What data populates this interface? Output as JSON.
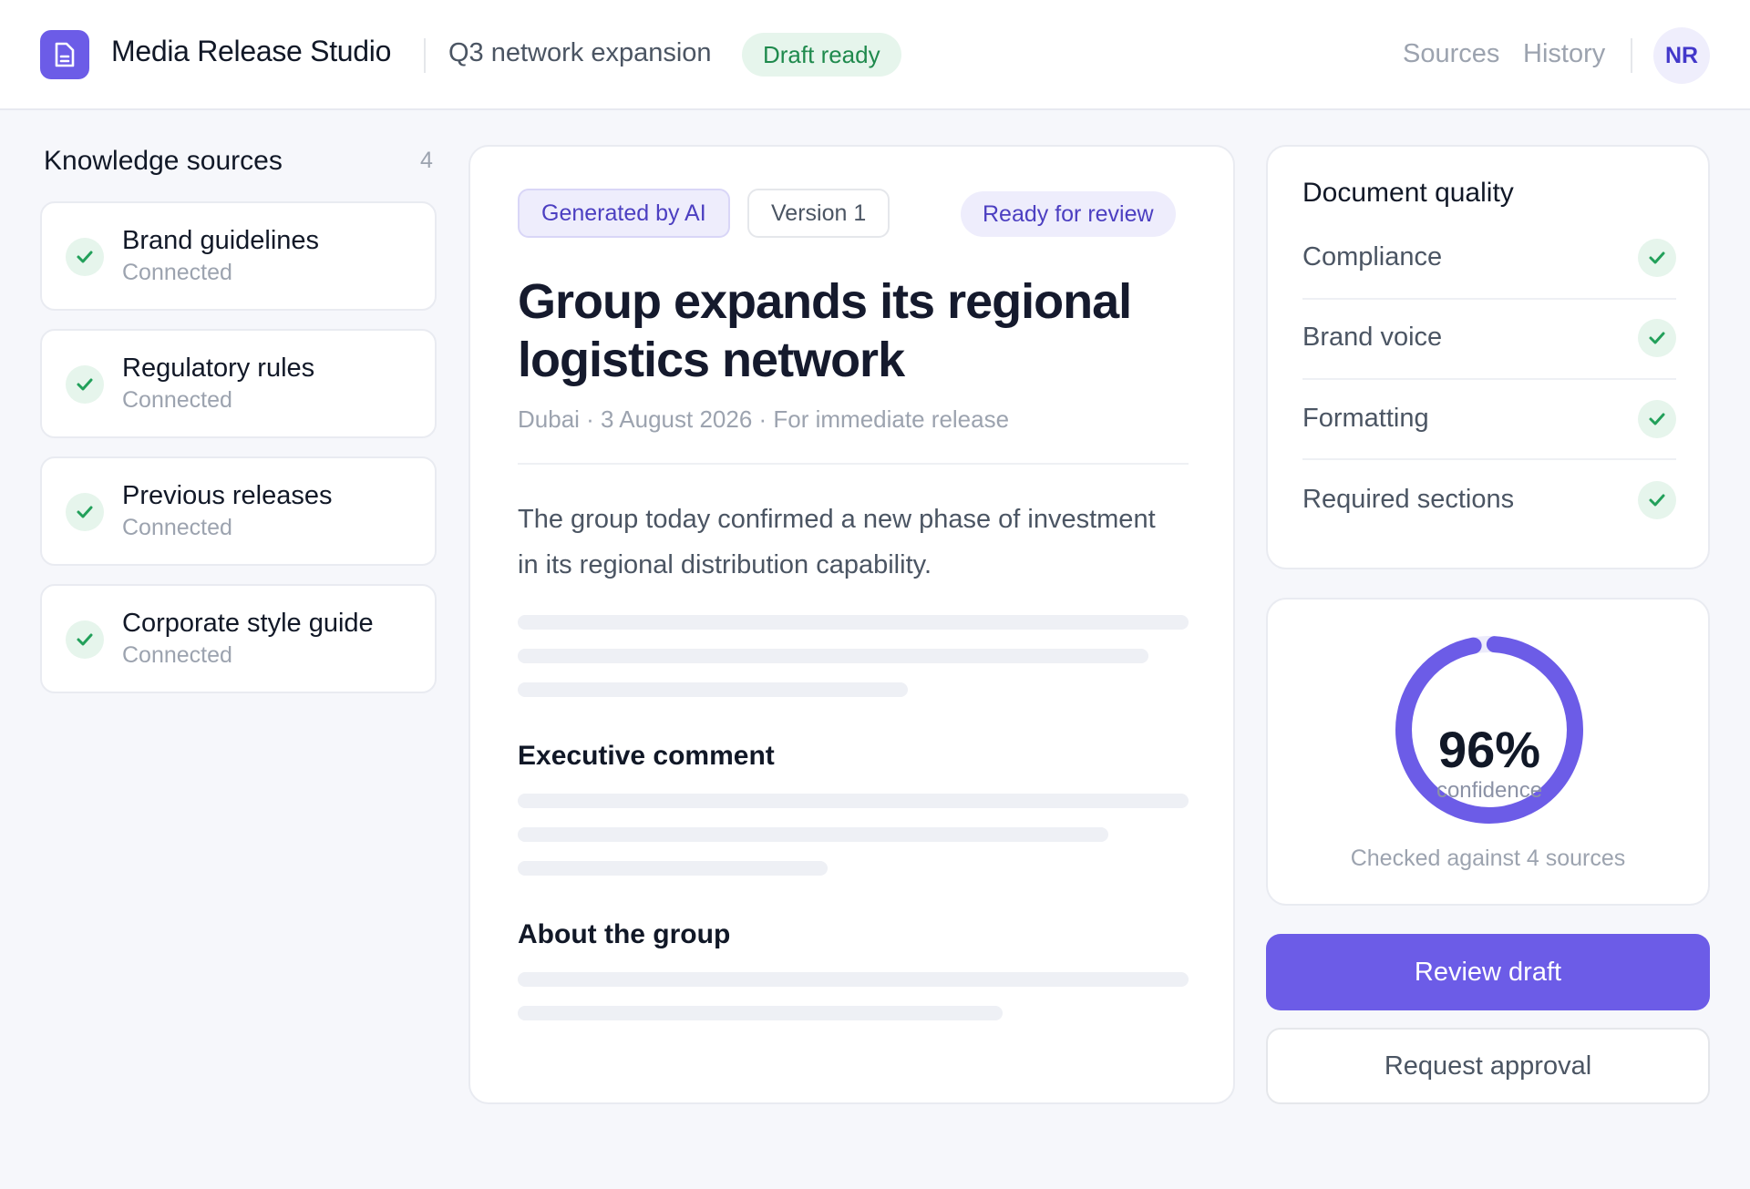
{
  "header": {
    "app_icon": "document-icon",
    "app_title": "Media Release Studio",
    "project_name": "Q3 network expansion",
    "status": "Draft ready",
    "nav": [
      {
        "label": "Sources"
      },
      {
        "label": "History"
      }
    ],
    "avatar_initials": "NR"
  },
  "sidebar": {
    "title": "Knowledge sources",
    "count": "4",
    "sources": [
      {
        "name": "Brand guidelines",
        "status": "Connected",
        "icon": "check-icon"
      },
      {
        "name": "Regulatory rules",
        "status": "Connected",
        "icon": "check-icon"
      },
      {
        "name": "Previous releases",
        "status": "Connected",
        "icon": "check-icon"
      },
      {
        "name": "Corporate style guide",
        "status": "Connected",
        "icon": "check-icon"
      }
    ]
  },
  "document": {
    "tags": {
      "generated": "Generated by AI",
      "version": "Version 1",
      "review_status": "Ready for review"
    },
    "headline": "Group expands its regional logistics network",
    "dateline": "Dubai · 3 August 2026 · For immediate release",
    "lead": "The group today confirmed a new phase of investment in its regional distribution capability.",
    "sections": [
      {
        "heading": "Executive comment"
      },
      {
        "heading": "About the group"
      }
    ]
  },
  "quality": {
    "title": "Document quality",
    "checks": [
      {
        "label": "Compliance",
        "passed": true
      },
      {
        "label": "Brand voice",
        "passed": true
      },
      {
        "label": "Formatting",
        "passed": true
      },
      {
        "label": "Required sections",
        "passed": true
      }
    ]
  },
  "confidence": {
    "value": 96,
    "value_label": "96%",
    "label": "confidence",
    "caption": "Checked against 4 sources"
  },
  "actions": {
    "primary": "Review draft",
    "secondary": "Request approval"
  },
  "colors": {
    "accent": "#6c5ce7",
    "success": "#22a05a",
    "success_bg": "#e6f5ec",
    "gauge_track": "#ecebfb"
  }
}
